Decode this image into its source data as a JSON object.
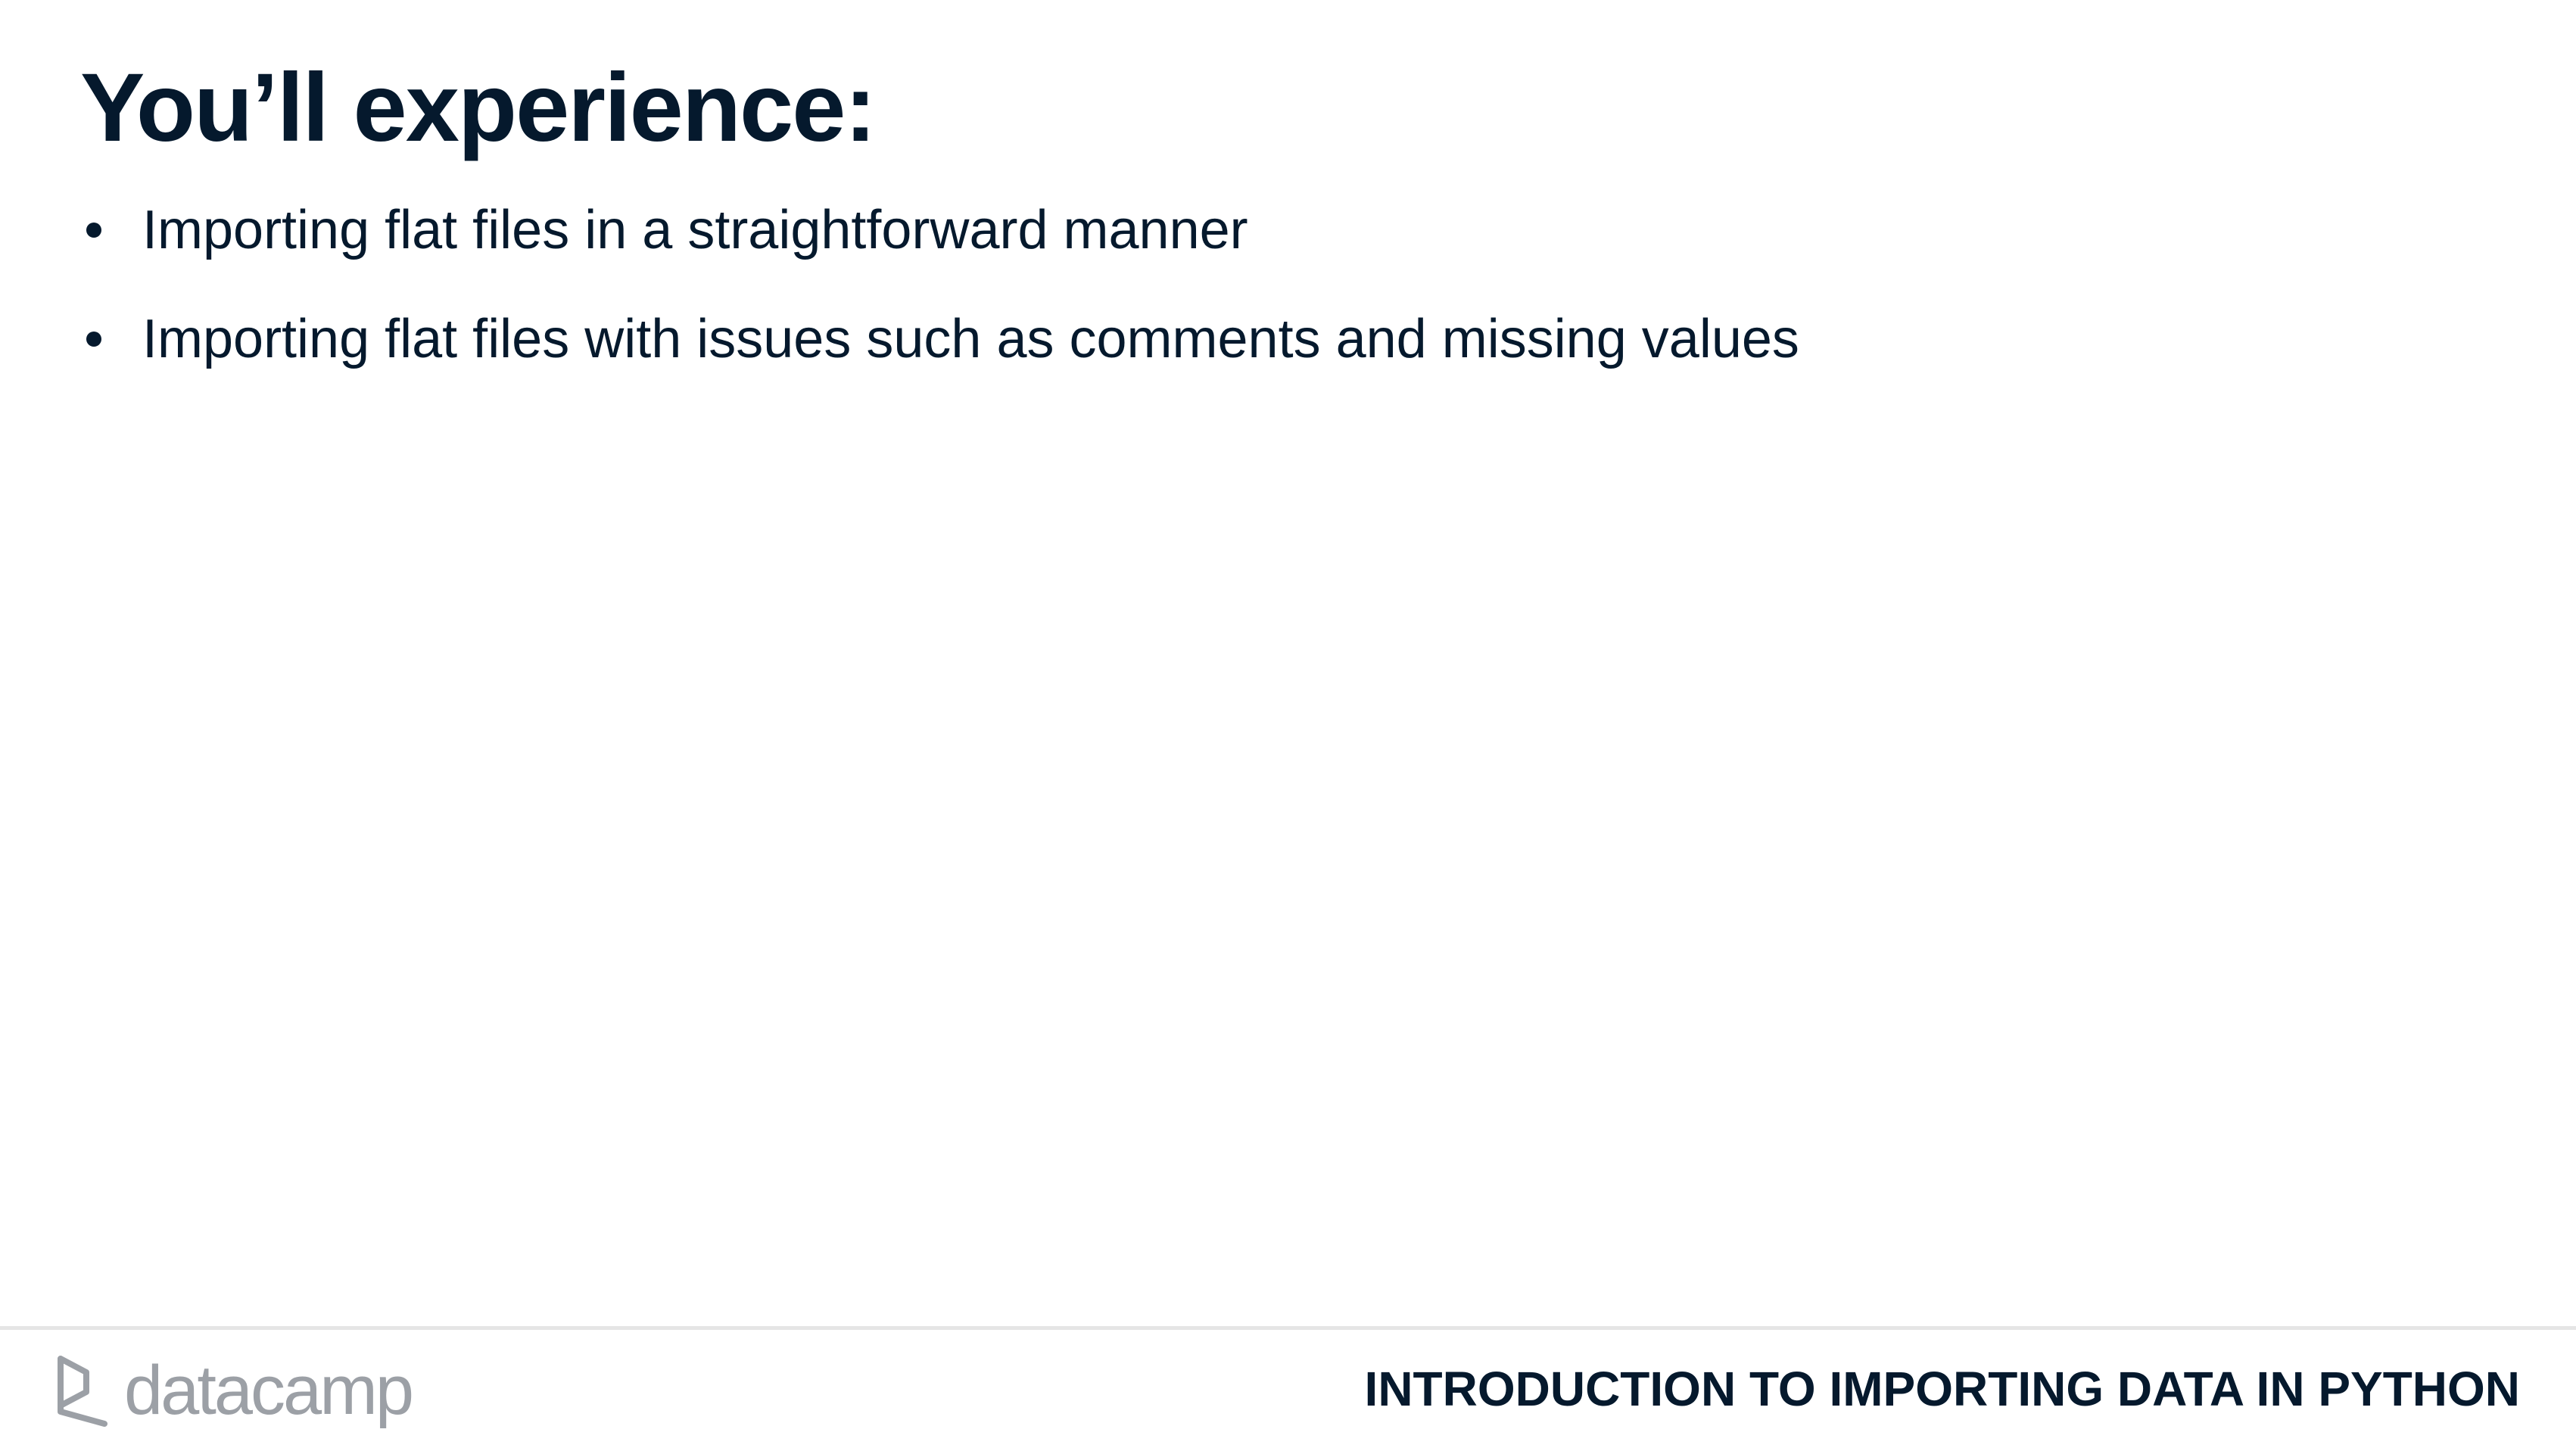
{
  "slide": {
    "title": "You’ll experience:",
    "bullets": [
      "Importing flat files in a straightforward manner",
      "Importing flat files with issues such as comments and missing values"
    ]
  },
  "footer": {
    "logo_text": "datacamp",
    "logo_icon": "datacamp-logo-icon",
    "course_title": "INTRODUCTION TO IMPORTING DATA IN PYTHON"
  },
  "colors": {
    "text": "#05192d",
    "logo_gray": "#9ca0a6",
    "divider": "#e5e5e5",
    "background": "#ffffff"
  }
}
